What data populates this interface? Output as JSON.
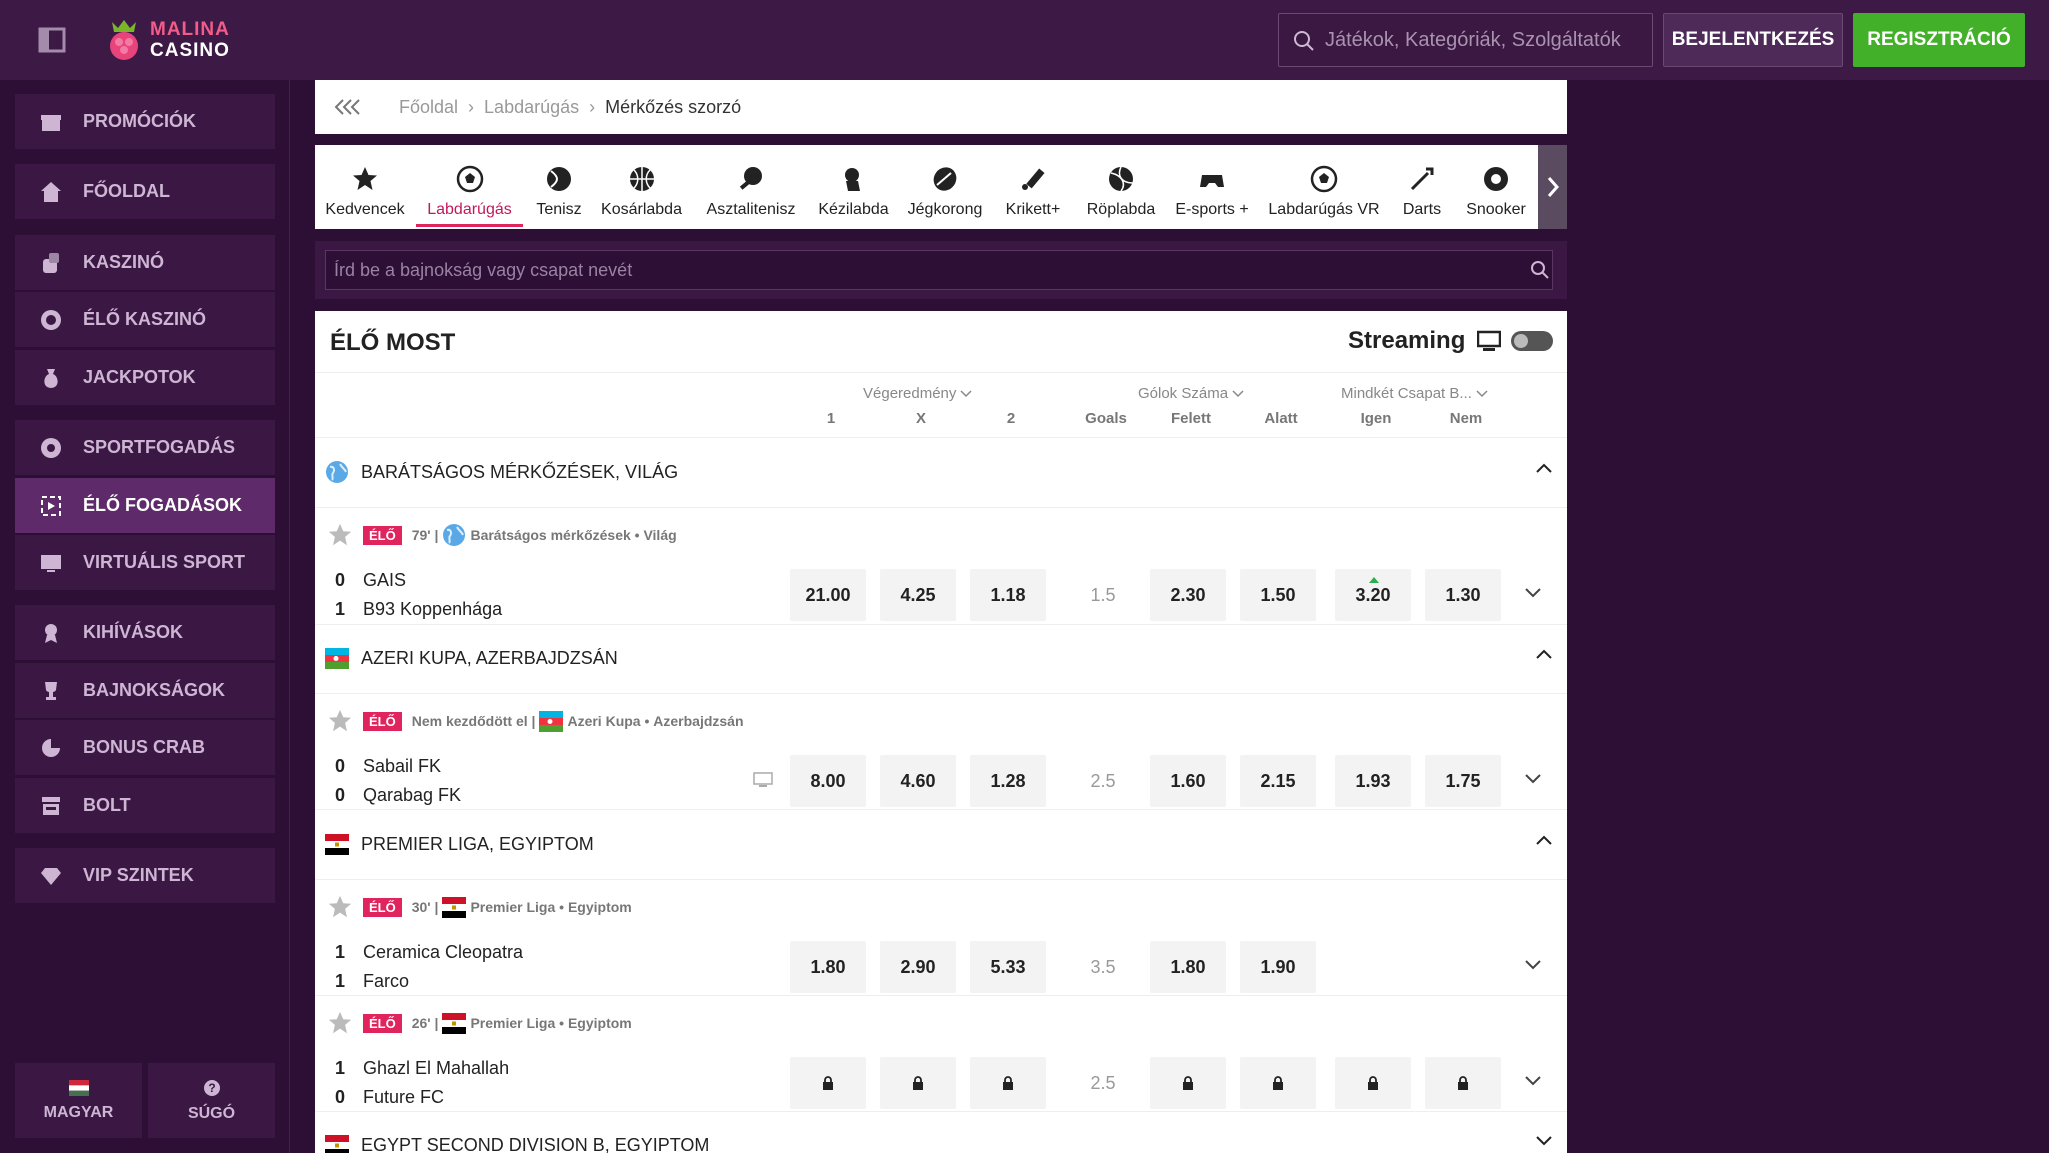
{
  "brand": {
    "line1": "MALINA",
    "line2": "CASINO"
  },
  "search": {
    "placeholder": "Játékok, Kategóriák, Szolgáltatók"
  },
  "auth": {
    "login": "BEJELENTKEZÉS",
    "register": "REGISZTRÁCIÓ"
  },
  "sidebar": {
    "items": [
      {
        "label": "PROMÓCIÓK",
        "icon": "gift-icon"
      },
      {
        "label": "FŐOLDAL",
        "icon": "home-icon"
      },
      {
        "label": "KASZINÓ",
        "icon": "dice-icon"
      },
      {
        "label": "ÉLŐ KASZINÓ",
        "icon": "chip-icon"
      },
      {
        "label": "JACKPOTOK",
        "icon": "sack-icon"
      },
      {
        "label": "SPORTFOGADÁS",
        "icon": "ball-icon"
      },
      {
        "label": "ÉLŐ FOGADÁSOK",
        "icon": "live-icon"
      },
      {
        "label": "VIRTUÁLIS SPORT",
        "icon": "screen-icon"
      },
      {
        "label": "KIHÍVÁSOK",
        "icon": "medal-icon"
      },
      {
        "label": "BAJNOKSÁGOK",
        "icon": "trophy-icon"
      },
      {
        "label": "BONUS CRAB",
        "icon": "crab-icon"
      },
      {
        "label": "BOLT",
        "icon": "shop-icon"
      },
      {
        "label": "VIP SZINTEK",
        "icon": "diamond-icon"
      }
    ],
    "active": "ÉLŐ FOGADÁSOK",
    "language": "MAGYAR",
    "help": "SÚGÓ"
  },
  "breadcrumb": {
    "items": [
      "Főoldal",
      "Labdarúgás"
    ],
    "current": "Mérkőzés szorzó"
  },
  "sports": {
    "items": [
      "Kedvencek",
      "Labdarúgás",
      "Tenisz",
      "Kosárlabda",
      "Asztalitenisz",
      "Kézilabda",
      "Jégkorong",
      "Krikett+",
      "Röplabda",
      "E-sports +",
      "Labdarúgás VR",
      "Darts",
      "Snooker"
    ],
    "active": "Labdarúgás"
  },
  "filter": {
    "placeholder": "Írd be a bajnokság vagy csapat nevét"
  },
  "live": {
    "title": "ÉLŐ MOST",
    "streaming": "Streaming",
    "groups": {
      "result": "Végeredmény",
      "goals": "Gólok Száma",
      "btts": "Mindkét Csapat B..."
    },
    "cols": {
      "one": "1",
      "x": "X",
      "two": "2",
      "goals": "Goals",
      "over": "Felett",
      "under": "Alatt",
      "yes": "Igen",
      "no": "Nem"
    },
    "leagues": [
      {
        "name": "BARÁTSÁGOS MÉRKŐZÉSEK, VILÁG"
      },
      {
        "name": "AZERI KUPA, AZERBAJDZSÁN"
      },
      {
        "name": "PREMIER LIGA, EGYIPTOM"
      },
      {
        "name": "EGYPT SECOND DIVISION B, EGYIPTOM"
      }
    ],
    "live_badge": "ÉLŐ",
    "matches": [
      {
        "time": "79' |",
        "comp": "Barátságos mérkőzések",
        "country": "Világ",
        "home": "GAIS",
        "away": "B93 Koppenhága",
        "hs": "0",
        "as": "1",
        "odds": [
          "21.00",
          "4.25",
          "1.18"
        ],
        "line": "1.5",
        "ou": [
          "2.30",
          "1.50"
        ],
        "btts": [
          "3.20",
          "1.30"
        ]
      },
      {
        "time": "Nem kezdődött el |",
        "comp": "Azeri Kupa",
        "country": "Azerbajdzsán",
        "home": "Sabail FK",
        "away": "Qarabag FK",
        "hs": "0",
        "as": "0",
        "odds": [
          "8.00",
          "4.60",
          "1.28"
        ],
        "line": "2.5",
        "ou": [
          "1.60",
          "2.15"
        ],
        "btts": [
          "1.93",
          "1.75"
        ]
      },
      {
        "time": "30' |",
        "comp": "Premier Liga",
        "country": "Egyiptom",
        "home": "Ceramica Cleopatra",
        "away": "Farco",
        "hs": "1",
        "as": "1",
        "odds": [
          "1.80",
          "2.90",
          "5.33"
        ],
        "line": "3.5",
        "ou": [
          "1.80",
          "1.90"
        ],
        "btts": []
      },
      {
        "time": "26' |",
        "comp": "Premier Liga",
        "country": "Egyiptom",
        "home": "Ghazl El Mahallah",
        "away": "Future FC",
        "hs": "1",
        "as": "0",
        "line": "2.5"
      }
    ]
  },
  "colors": {
    "bg": "#2d0e35",
    "accent": "#e0245e",
    "register": "#43b02a"
  }
}
